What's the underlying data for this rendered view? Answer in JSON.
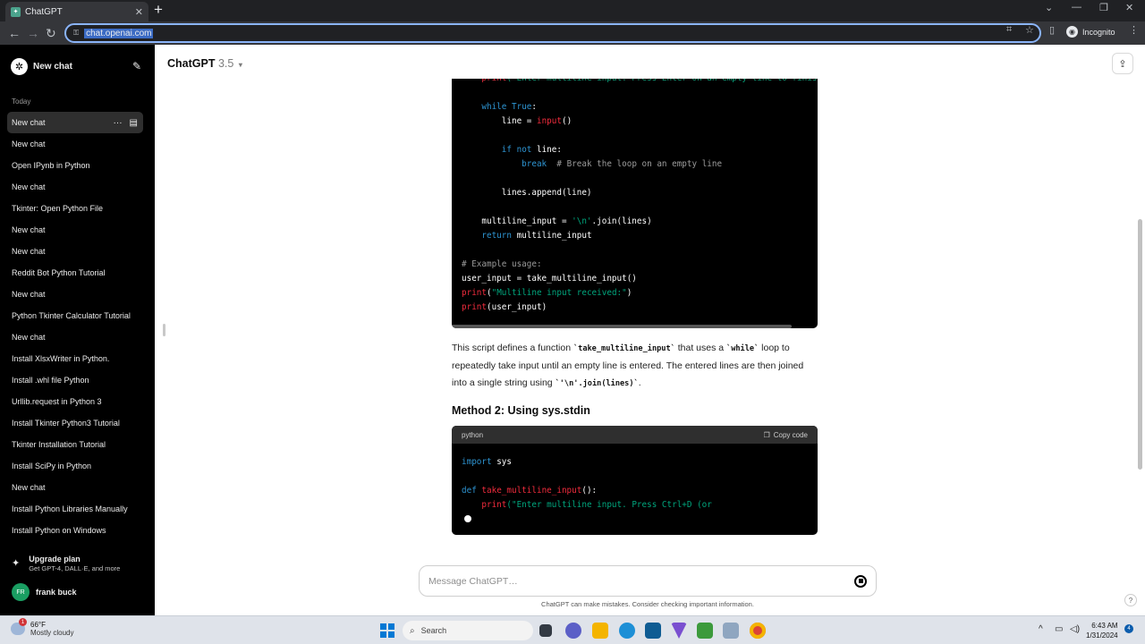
{
  "browser": {
    "tab_title": "ChatGPT",
    "url": "chat.openai.com",
    "profile_label": "Incognito"
  },
  "sidebar": {
    "new_chat_label": "New chat",
    "section_label": "Today",
    "history": [
      {
        "label": "New chat",
        "active": true
      },
      {
        "label": "New chat"
      },
      {
        "label": "Open IPynb in Python"
      },
      {
        "label": "New chat"
      },
      {
        "label": "Tkinter: Open Python File"
      },
      {
        "label": "New chat"
      },
      {
        "label": "New chat"
      },
      {
        "label": "Reddit Bot Python Tutorial"
      },
      {
        "label": "New chat"
      },
      {
        "label": "Python Tkinter Calculator Tutorial"
      },
      {
        "label": "New chat"
      },
      {
        "label": "Install XlsxWriter in Python."
      },
      {
        "label": "Install .whl file Python"
      },
      {
        "label": "Urllib.request in Python 3"
      },
      {
        "label": "Install Tkinter Python3 Tutorial"
      },
      {
        "label": "Tkinter Installation Tutorial"
      },
      {
        "label": "Install SciPy in Python"
      },
      {
        "label": "New chat"
      },
      {
        "label": "Install Python Libraries Manually"
      },
      {
        "label": "Install Python on Windows"
      }
    ],
    "upgrade_title": "Upgrade plan",
    "upgrade_subtitle": "Get GPT-4, DALL·E, and more",
    "user_initials": "FR",
    "user_name": "frank buck"
  },
  "header": {
    "model_name": "ChatGPT",
    "model_version": "3.5"
  },
  "code_block_1": {
    "lines": [
      [
        {
          "t": "    "
        },
        {
          "t": "print",
          "c": "fn"
        },
        {
          "t": "(\"Enter multiline input. Press Enter on an empty line to finish",
          "c": "str"
        }
      ],
      [
        {
          "t": ""
        }
      ],
      [
        {
          "t": "    "
        },
        {
          "t": "while",
          "c": "kw"
        },
        {
          "t": " "
        },
        {
          "t": "True",
          "c": "kw"
        },
        {
          "t": ":"
        }
      ],
      [
        {
          "t": "        line = "
        },
        {
          "t": "input",
          "c": "fn"
        },
        {
          "t": "()"
        }
      ],
      [
        {
          "t": ""
        }
      ],
      [
        {
          "t": "        "
        },
        {
          "t": "if",
          "c": "kw"
        },
        {
          "t": " "
        },
        {
          "t": "not",
          "c": "kw"
        },
        {
          "t": " line:"
        }
      ],
      [
        {
          "t": "            "
        },
        {
          "t": "break",
          "c": "kw"
        },
        {
          "t": "  "
        },
        {
          "t": "# Break the loop on an empty line",
          "c": "cm"
        }
      ],
      [
        {
          "t": ""
        }
      ],
      [
        {
          "t": "        lines.append(line)"
        }
      ],
      [
        {
          "t": ""
        }
      ],
      [
        {
          "t": "    multiline_input = "
        },
        {
          "t": "'\\n'",
          "c": "str"
        },
        {
          "t": ".join(lines)"
        }
      ],
      [
        {
          "t": "    "
        },
        {
          "t": "return",
          "c": "kw"
        },
        {
          "t": " multiline_input"
        }
      ],
      [
        {
          "t": ""
        }
      ],
      [
        {
          "t": "# Example usage:",
          "c": "cm"
        }
      ],
      [
        {
          "t": "user_input = take_multiline_input()"
        }
      ],
      [
        {
          "t": "print",
          "c": "fn"
        },
        {
          "t": "("
        },
        {
          "t": "\"Multiline input received:\"",
          "c": "str"
        },
        {
          "t": ")"
        }
      ],
      [
        {
          "t": "print",
          "c": "fn"
        },
        {
          "t": "(user_input)"
        }
      ]
    ]
  },
  "explanation": {
    "p1": "This script defines a function ",
    "c1": "`take_multiline_input`",
    "p2": " that uses a ",
    "c2": "`while`",
    "p3": " loop to repeatedly take input until an empty line is entered. The entered lines are then joined into a single string using ",
    "c3": "`'\\n'.join(lines)`",
    "p4": "."
  },
  "method2_heading": "Method 2: Using sys.stdin",
  "code_block_2": {
    "language": "python",
    "copy_label": "Copy code",
    "lines": [
      [
        {
          "t": "import",
          "c": "kw"
        },
        {
          "t": " sys"
        }
      ],
      [
        {
          "t": ""
        }
      ],
      [
        {
          "t": "def",
          "c": "kw"
        },
        {
          "t": " "
        },
        {
          "t": "take_multiline_input",
          "c": "fn"
        },
        {
          "t": "():"
        }
      ],
      [
        {
          "t": "    "
        },
        {
          "t": "print",
          "c": "fn"
        },
        {
          "t": "(\"Enter multiline input. Press Ctrl+D (or",
          "c": "str"
        }
      ]
    ]
  },
  "composer": {
    "placeholder": "Message ChatGPT…",
    "disclaimer": "ChatGPT can make mistakes. Consider checking important information."
  },
  "taskbar": {
    "temperature": "66°F",
    "weather": "Mostly cloudy",
    "weather_badge": "1",
    "search_label": "Search",
    "time": "6:43 AM",
    "date": "1/31/2024",
    "notification_count": "4"
  },
  "colors": {
    "keyword": "#2e95d3",
    "function": "#f22c3d",
    "string": "#00a67d",
    "comment": "#9b9b9b",
    "sidebar_bg": "#000000"
  }
}
